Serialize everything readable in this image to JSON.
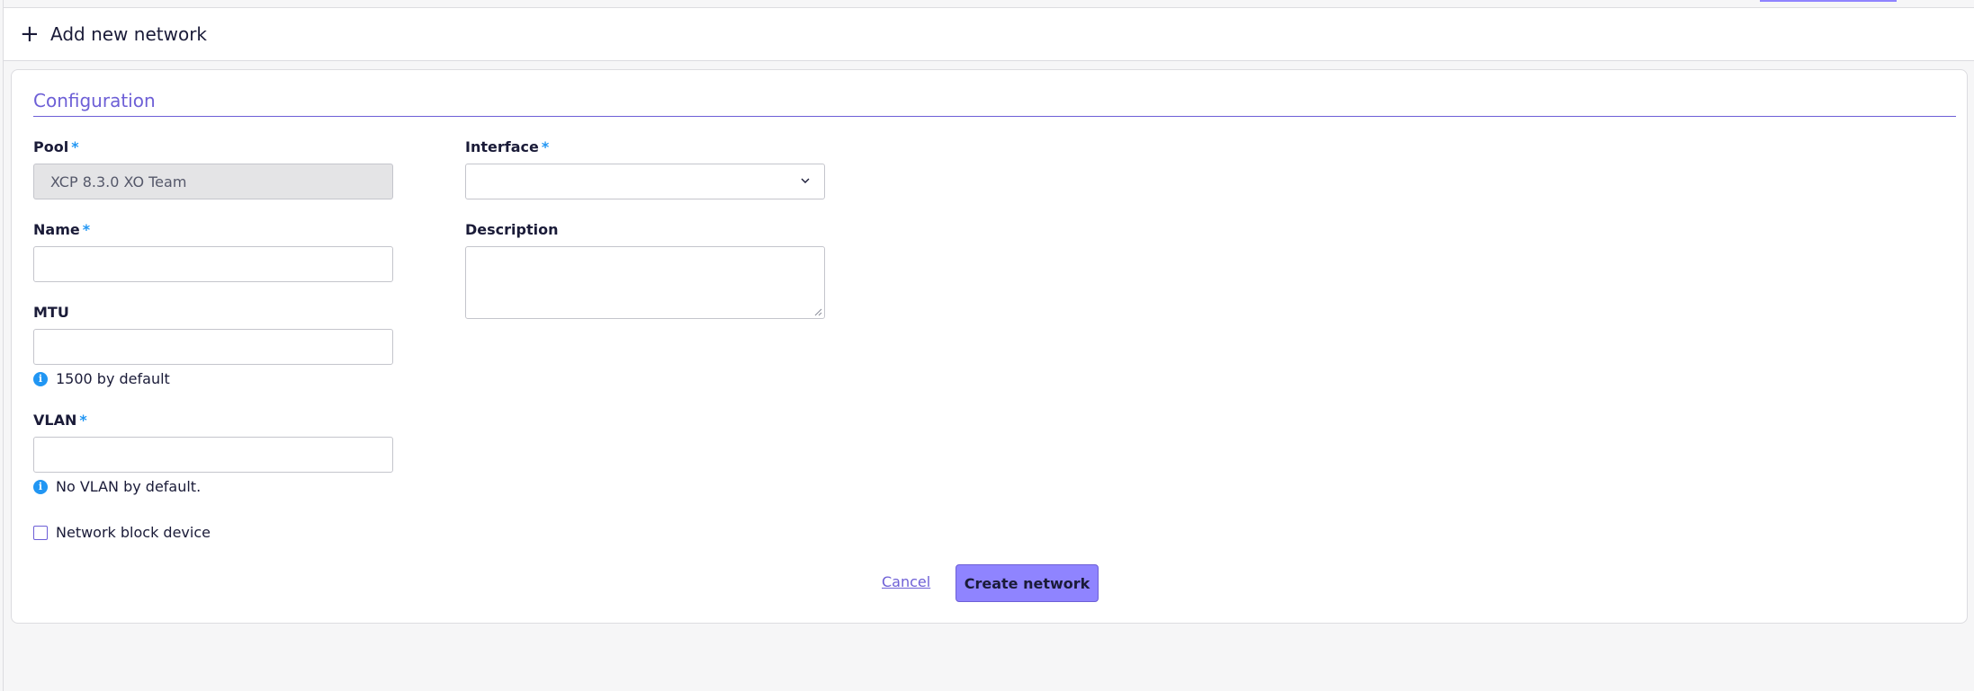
{
  "header": {
    "title": "Add new network",
    "icon": "plus-icon"
  },
  "form": {
    "section_title": "Configuration",
    "required_marker": "*",
    "pool": {
      "label": "Pool",
      "value": "XCP 8.3.0 XO Team",
      "disabled": true
    },
    "interface": {
      "label": "Interface",
      "value": ""
    },
    "name": {
      "label": "Name",
      "value": ""
    },
    "description": {
      "label": "Description",
      "value": ""
    },
    "mtu": {
      "label": "MTU",
      "value": "",
      "hint": "1500 by default"
    },
    "vlan": {
      "label": "VLAN",
      "value": "",
      "hint": "No VLAN by default."
    },
    "nbd": {
      "label": "Network block device",
      "checked": false
    }
  },
  "actions": {
    "cancel_label": "Cancel",
    "create_label": "Create network"
  },
  "colors": {
    "accent": "#8f84ff",
    "accent_dark": "#6d5fd6",
    "info": "#2196f3",
    "text": "#1a1b38"
  }
}
